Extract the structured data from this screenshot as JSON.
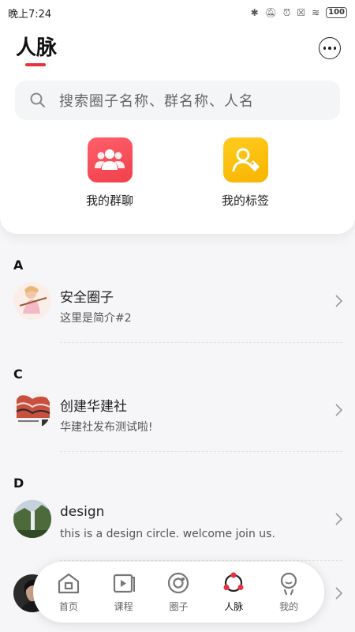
{
  "status_bar": {
    "time": "晚上7:24",
    "battery": "100"
  },
  "header": {
    "title": "人脉",
    "search_placeholder": "搜索圈子名称、群名称、人名",
    "shortcuts": [
      {
        "label": "我的群聊",
        "icon": "group-chat-icon"
      },
      {
        "label": "我的标签",
        "icon": "tag-user-icon"
      }
    ]
  },
  "sections": [
    {
      "letter": "A",
      "items": [
        {
          "name": "安全圈子",
          "desc": "这里是简介#2"
        }
      ]
    },
    {
      "letter": "C",
      "items": [
        {
          "name": "创建华建社",
          "desc": "华建社发布测试啦!"
        }
      ]
    },
    {
      "letter": "D",
      "items": [
        {
          "name": "design",
          "desc": "this is a design circle. welcome join us."
        },
        {
          "name": "",
          "desc": ""
        }
      ]
    }
  ],
  "tabs": [
    {
      "label": "首页",
      "icon": "home-icon",
      "active": false
    },
    {
      "label": "课程",
      "icon": "video-play-icon",
      "active": false
    },
    {
      "label": "圈子",
      "icon": "circle-icon",
      "active": false
    },
    {
      "label": "人脉",
      "icon": "network-icon",
      "active": true
    },
    {
      "label": "我的",
      "icon": "profile-icon",
      "active": false
    }
  ],
  "colors": {
    "accent": "#e8323c",
    "group_icon_bg": "#f0404b",
    "tag_icon_bg": "#f7b500"
  }
}
